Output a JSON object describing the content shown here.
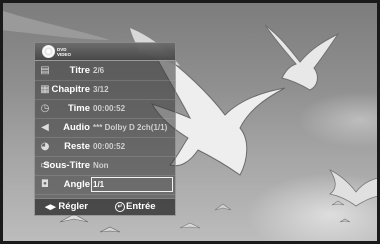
{
  "disc": {
    "logo_line1": "DVD",
    "logo_line2": "VIDEO"
  },
  "info_rows": [
    {
      "label": "Titre",
      "value": "2/6",
      "icon": "title-icon"
    },
    {
      "label": "Chapitre",
      "value": "3/12",
      "icon": "chapter-icon"
    },
    {
      "label": "Time",
      "value": "00:00:52",
      "icon": "clock-icon"
    },
    {
      "label": "Audio",
      "value": "*** Dolby D 2ch(1/1)",
      "icon": "speaker-icon"
    },
    {
      "label": "Reste",
      "value": "00:00:52",
      "icon": "remaining-icon"
    },
    {
      "label": "Sous-Titre",
      "value": "Non",
      "icon": "subtitle-icon"
    },
    {
      "label": "Angle",
      "value": "1/1",
      "icon": "camera-angle-icon",
      "selected": true
    }
  ],
  "footer": {
    "adjust_label": "Régler",
    "enter_label": "Entrée"
  },
  "colors": {
    "panel_bg": "#373737",
    "selection_border": "#f2f2f2",
    "label_text": "#ffffff",
    "value_text": "#cfcfcf"
  }
}
